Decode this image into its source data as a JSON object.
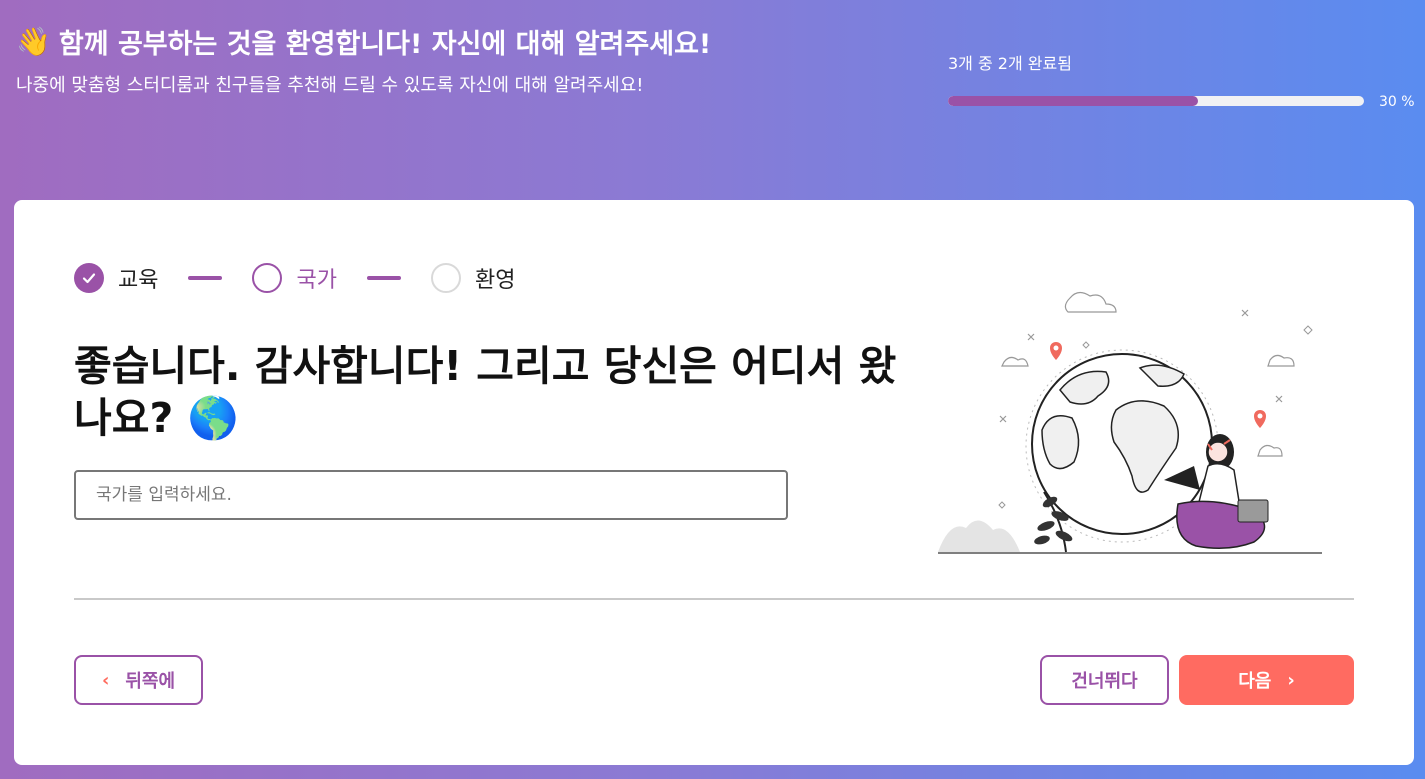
{
  "header": {
    "wave_emoji": "👋",
    "title": "함께 공부하는 것을 환영합니다! 자신에 대해 알려주세요!",
    "subtitle": "나중에 맞춤형 스터디룸과 친구들을 추천해 드릴 수 있도록 자신에 대해 알려주세요!"
  },
  "progress": {
    "label": "3개 중 2개 완료됨",
    "percent_text": "30 %",
    "fill_percent": 60
  },
  "steps": [
    {
      "label": "교육",
      "state": "done"
    },
    {
      "label": "국가",
      "state": "active"
    },
    {
      "label": "환영",
      "state": "todo"
    }
  ],
  "question": {
    "text": "좋습니다. 감사합니다! 그리고 당신은 어디서 왔나요?",
    "emoji": "🌎"
  },
  "country_input": {
    "placeholder": "국가를 입력하세요.",
    "value": ""
  },
  "buttons": {
    "back_label": "뒤쪽에",
    "skip_label": "건너뛰다",
    "next_label": "다음"
  },
  "colors": {
    "accent": "#9a52a7",
    "next_button": "#ff6b61"
  }
}
